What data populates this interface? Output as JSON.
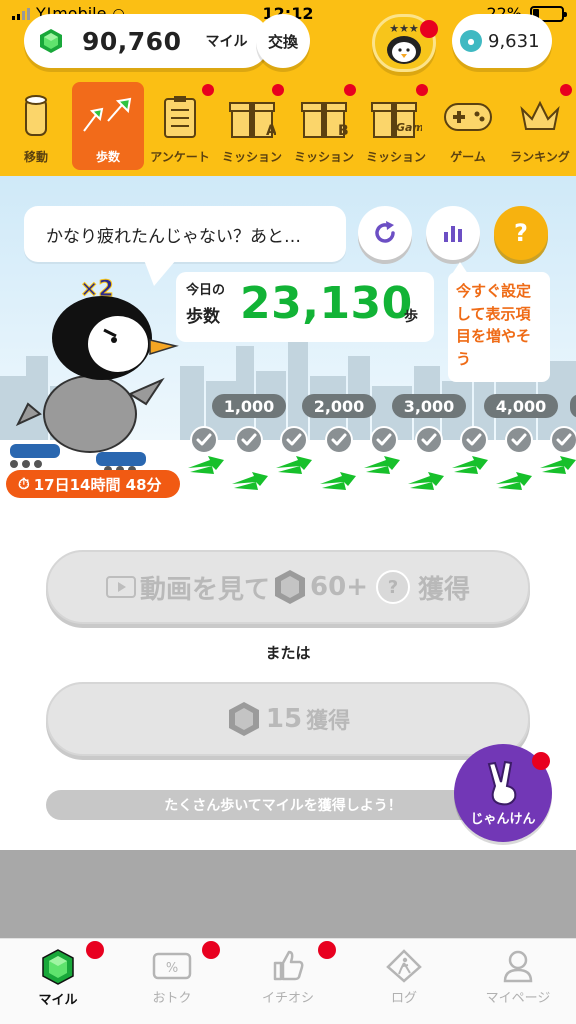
{
  "status_bar": {
    "carrier": "Y!mobile",
    "time": "12:12",
    "battery": "22%"
  },
  "header": {
    "miles": {
      "value": "90,760",
      "unit": "マイル"
    },
    "exchange_label": "交換",
    "coins": {
      "value": "9,631"
    }
  },
  "nav": [
    {
      "label": "移動",
      "icon": "cylinder-icon"
    },
    {
      "label": "歩数",
      "icon": "footprints-icon",
      "active": true
    },
    {
      "label": "アンケート",
      "icon": "clipboard-icon"
    },
    {
      "label": "ミッション",
      "icon": "gift-a-icon",
      "badge": "A"
    },
    {
      "label": "ミッション",
      "icon": "gift-b-icon",
      "badge": "B"
    },
    {
      "label": "ミッション",
      "icon": "gift-game-icon",
      "badge": "Game"
    },
    {
      "label": "ゲーム",
      "icon": "gamepad-icon"
    },
    {
      "label": "ランキング",
      "icon": "crown-icon"
    }
  ],
  "steps": {
    "speech": "かなり疲れたんじゃない？あと…",
    "multiplier": "×2",
    "today_label_1": "今日の",
    "today_label_2": "歩数",
    "value": "23,130",
    "unit": "歩",
    "hint": "今すぐ設定して表示項目を増やそう",
    "milestones": [
      "1,000",
      "2,000",
      "3,000",
      "4,000"
    ],
    "timer": "17日14時間 48分"
  },
  "actions": {
    "video_label": "動画を見て",
    "video_amount": "60+",
    "video_suffix": "獲得",
    "or_label": "または",
    "claim_amount": "15",
    "claim_suffix": "獲得",
    "hint_bar": "たくさん歩いてマイルを獲得しよう！",
    "janken_label": "じゃんけん"
  },
  "tabs": [
    {
      "label": "マイル",
      "active": true
    },
    {
      "label": "おトク"
    },
    {
      "label": "イチオシ"
    },
    {
      "label": "ログ"
    },
    {
      "label": "マイページ"
    }
  ],
  "colors": {
    "header_bg": "#fbbf14",
    "accent_orange": "#f26b1a",
    "step_green": "#12b336",
    "badge_red": "#e8001f",
    "janken_purple": "#7237b6"
  }
}
